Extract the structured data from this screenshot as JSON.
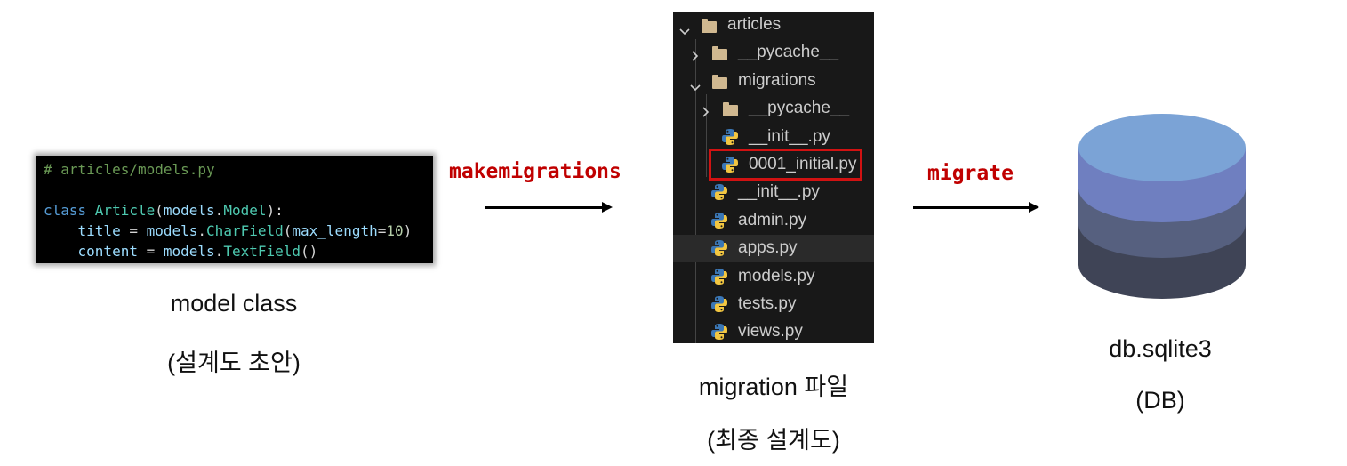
{
  "code": {
    "comment": "# articles/models.py",
    "line2": [
      {
        "t": "class ",
        "c": "kw"
      },
      {
        "t": "Article",
        "c": "cls"
      },
      {
        "t": "(",
        "c": "txt"
      },
      {
        "t": "models",
        "c": "var"
      },
      {
        "t": ".",
        "c": "txt"
      },
      {
        "t": "Model",
        "c": "cls"
      },
      {
        "t": "):",
        "c": "txt"
      }
    ],
    "line3": [
      {
        "t": "    ",
        "c": "txt"
      },
      {
        "t": "title",
        "c": "var"
      },
      {
        "t": " = ",
        "c": "txt"
      },
      {
        "t": "models",
        "c": "var"
      },
      {
        "t": ".",
        "c": "txt"
      },
      {
        "t": "CharField",
        "c": "fn"
      },
      {
        "t": "(",
        "c": "txt"
      },
      {
        "t": "max_length",
        "c": "var"
      },
      {
        "t": "=",
        "c": "txt"
      },
      {
        "t": "10",
        "c": "num"
      },
      {
        "t": ")",
        "c": "txt"
      }
    ],
    "line4": [
      {
        "t": "    ",
        "c": "txt"
      },
      {
        "t": "content",
        "c": "var"
      },
      {
        "t": " = ",
        "c": "txt"
      },
      {
        "t": "models",
        "c": "var"
      },
      {
        "t": ".",
        "c": "txt"
      },
      {
        "t": "TextField",
        "c": "fn"
      },
      {
        "t": "()",
        "c": "txt"
      }
    ]
  },
  "model_caption": {
    "line1": "model class",
    "line2": "(설계도 초안)"
  },
  "command1": "makemigrations",
  "command2": "migrate",
  "explorer": {
    "rows": [
      {
        "label": "articles",
        "kind": "folder-open",
        "depth": 0
      },
      {
        "label": "__pycache__",
        "kind": "folder-closed",
        "depth": 1
      },
      {
        "label": "migrations",
        "kind": "folder-open",
        "depth": 1
      },
      {
        "label": "__pycache__",
        "kind": "folder-closed",
        "depth": 2
      },
      {
        "label": "__init__.py",
        "kind": "python",
        "depth": 2
      },
      {
        "label": "0001_initial.py",
        "kind": "python",
        "depth": 2,
        "highlighted_box": true
      },
      {
        "label": "__init__.py",
        "kind": "python",
        "depth": 1
      },
      {
        "label": "admin.py",
        "kind": "python",
        "depth": 1
      },
      {
        "label": "apps.py",
        "kind": "python",
        "depth": 1,
        "hover": true
      },
      {
        "label": "models.py",
        "kind": "python",
        "depth": 1
      },
      {
        "label": "tests.py",
        "kind": "python",
        "depth": 1
      },
      {
        "label": "views.py",
        "kind": "python",
        "depth": 1
      }
    ]
  },
  "migration_caption": {
    "line1": "migration 파일",
    "line2": "(최종 설계도)"
  },
  "db_caption": {
    "line1": "db.sqlite3",
    "line2": "(DB)"
  },
  "colors": {
    "command": "#c00000",
    "db_top": "#7ba3d6",
    "db_layer1": "#6f7fc0",
    "db_layer2": "#56607f",
    "db_layer3": "#3f4456",
    "highlight_box": "#d11212"
  }
}
